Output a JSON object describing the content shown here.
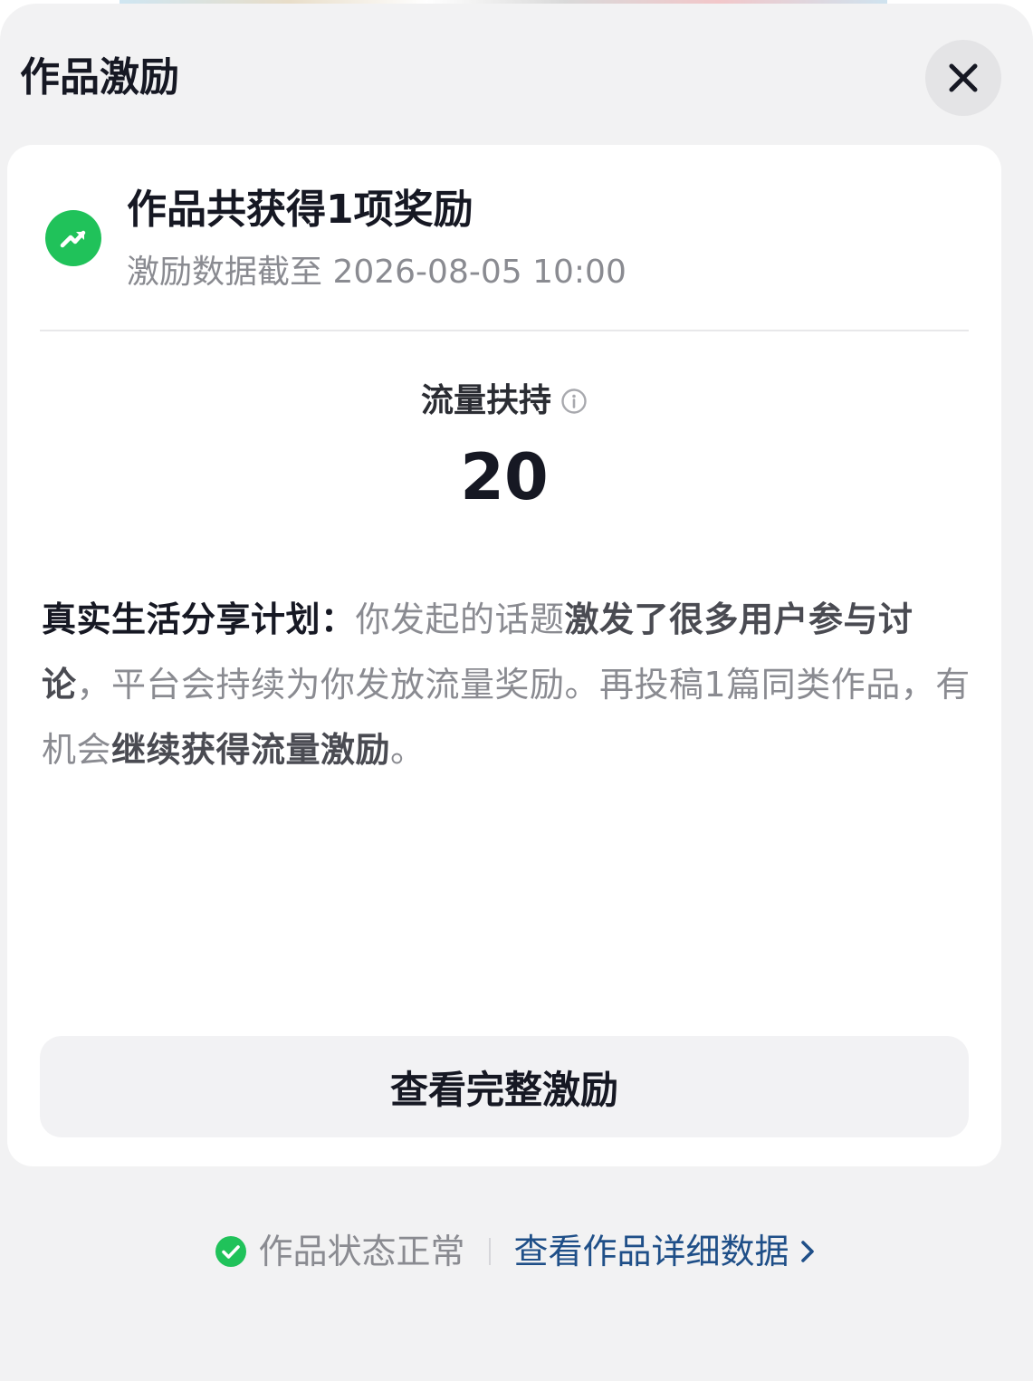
{
  "sheet": {
    "title": "作品激励",
    "close_icon": "close-icon"
  },
  "summary": {
    "icon": "trending-up-icon",
    "icon_color": "#20c25a",
    "title": "作品共获得1项奖励",
    "subtitle": "激励数据截至 2026-08-05 10:00"
  },
  "metric": {
    "label": "流量扶持",
    "info_icon": "info-icon",
    "value": "20"
  },
  "description": {
    "lead": "真实生活分享计划：",
    "part1": "你发起的话题",
    "em1": "激发了很多用户参与讨论",
    "part2": "，平台会持续为你发放流量奖励。再投稿1篇同类作品，有机会",
    "em2": "继续获得流量激励",
    "part3": "。"
  },
  "actions": {
    "full_incentive_label": "查看完整激励"
  },
  "footer": {
    "status_icon": "check-circle-icon",
    "status_color": "#20c25a",
    "status_text": "作品状态正常",
    "detail_link": "查看作品详细数据",
    "link_color": "#1f4f88"
  }
}
